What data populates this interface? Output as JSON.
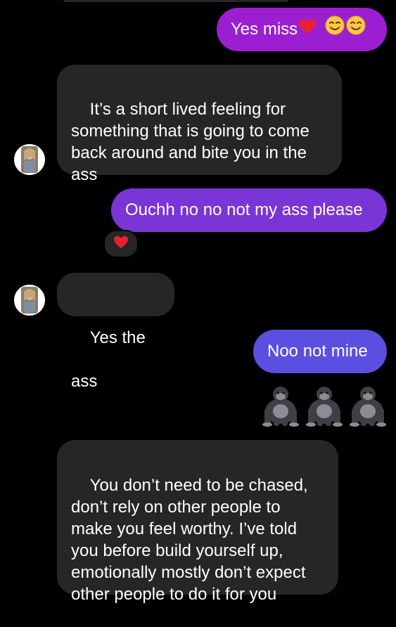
{
  "messages": [
    {
      "id": "m1",
      "direction": "outgoing",
      "text": "Yes miss",
      "emoji": [
        "red-heart",
        "smiling-face",
        "smiling-face"
      ]
    },
    {
      "id": "m2",
      "direction": "incoming",
      "text": "It’s a short lived feeling for\nsomething that is going to come\nback around and bite you in the\nass"
    },
    {
      "id": "m3",
      "direction": "outgoing",
      "text": "Ouchh no no not my ass please",
      "reaction": "red-heart"
    },
    {
      "id": "m4",
      "direction": "incoming",
      "text": "Yes the ass"
    },
    {
      "id": "m5",
      "direction": "outgoing",
      "text": "Noo not mine"
    },
    {
      "id": "m6",
      "direction": "outgoing",
      "emoji_only": [
        "gorilla",
        "gorilla",
        "gorilla"
      ]
    },
    {
      "id": "m7",
      "direction": "incoming",
      "text": "You don’t need to be chased,\ndon’t rely on other people to\nmake you feel worthy. I’ve told\nyou before build yourself up,\nemotionally mostly don’t expect\nother people to do it for you"
    }
  ],
  "colors": {
    "background": "#000000",
    "incoming_bubble": "#262626",
    "outgoing_gradient_top": "#9b1fd0",
    "outgoing_gradient_mid": "#7a3ad8",
    "outgoing_gradient_bottom": "#5b4ee0",
    "text": "#ffffff"
  }
}
